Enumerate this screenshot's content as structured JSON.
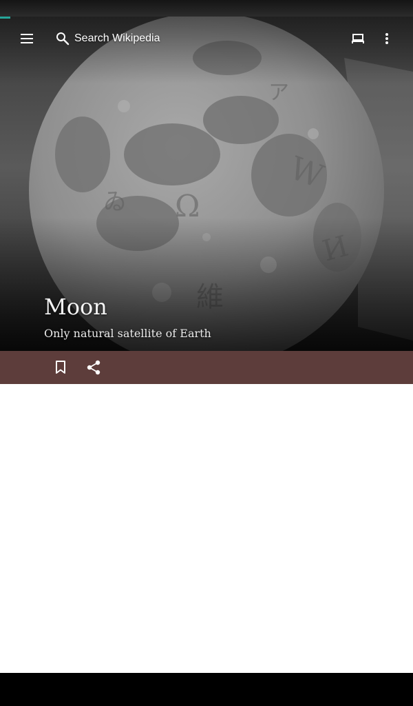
{
  "status_bar": {},
  "toolbar": {
    "menu_icon": "hamburger-menu-icon",
    "search_icon": "search-icon",
    "search_placeholder": "Search Wikipedia",
    "tabs_icon": "tabs-icon",
    "overflow_icon": "more-vert-icon"
  },
  "article": {
    "title": "Moon",
    "description": "Only natural satellite of Earth"
  },
  "action_bar": {
    "bookmark_icon": "bookmark-icon",
    "share_icon": "share-icon"
  },
  "colors": {
    "action_bar": "#5d3d3b",
    "progress": "#26a69a",
    "content_bg": "#ffffff",
    "nav_bar": "#000000"
  }
}
